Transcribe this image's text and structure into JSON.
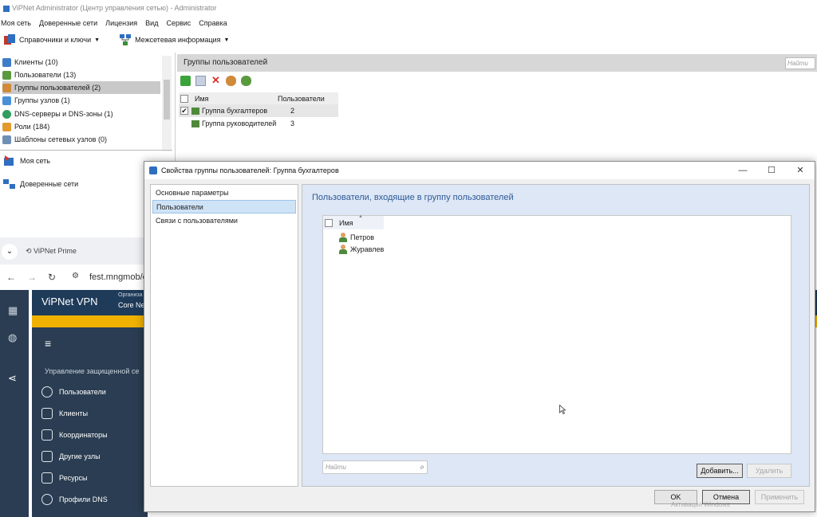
{
  "admin": {
    "title": "ViPNet Administrator (Центр управления сетью) - Administrator",
    "menu": [
      "Моя сеть",
      "Доверенные сети",
      "Лицензия",
      "Вид",
      "Сервис",
      "Справка"
    ],
    "toolbar": {
      "directories": "Справочники и ключи",
      "interwork": "Межсетевая информация"
    },
    "nav": {
      "items": [
        {
          "label": "Клиенты (10)",
          "icon": "clients-icon"
        },
        {
          "label": "Пользователи (13)",
          "icon": "users-icon"
        },
        {
          "label": "Группы пользователей (2)",
          "icon": "user-groups-icon"
        },
        {
          "label": "Группы узлов (1)",
          "icon": "node-groups-icon"
        },
        {
          "label": "DNS-серверы и DNS-зоны (1)",
          "icon": "dns-icon"
        },
        {
          "label": "Роли (184)",
          "icon": "roles-icon"
        },
        {
          "label": "Шаблоны сетевых узлов (0)",
          "icon": "templates-icon"
        }
      ],
      "my_network": "Моя сеть",
      "trusted_networks": "Доверенные сети"
    },
    "main": {
      "title": "Группы пользователей",
      "find_placeholder": "Найти",
      "columns": [
        "Имя",
        "Пользователи"
      ],
      "rows": [
        {
          "name": "Группа бухгалтеров",
          "users": "2"
        },
        {
          "name": "Группа руководителей",
          "users": "3"
        }
      ]
    }
  },
  "browser": {
    "tab_title": "ViPNet Prime",
    "url": "fest.mngmob/c",
    "app": {
      "brand": "ViPNet VPN",
      "org_label": "Организа",
      "org_value": "Core Ne",
      "section": "Управление защищенной се",
      "items": [
        "Пользователи",
        "Клиенты",
        "Координаторы",
        "Другие узлы",
        "Ресурсы",
        "Профили DNS"
      ]
    }
  },
  "dialog": {
    "title": "Свойства группы пользователей: Группа бухгалтеров",
    "nav": [
      "Основные параметры",
      "Пользователи",
      "Связи с пользователями"
    ],
    "panel_title": "Пользователи, входящие в группу пользователей",
    "column": "Имя",
    "members": [
      "Петров",
      "Журавлев"
    ],
    "search_placeholder": "Найти",
    "buttons": {
      "add": "Добавить...",
      "remove": "Удалить",
      "ok": "OK",
      "cancel": "Отмена",
      "apply": "Применить"
    },
    "watermark": "Активация Windows"
  }
}
